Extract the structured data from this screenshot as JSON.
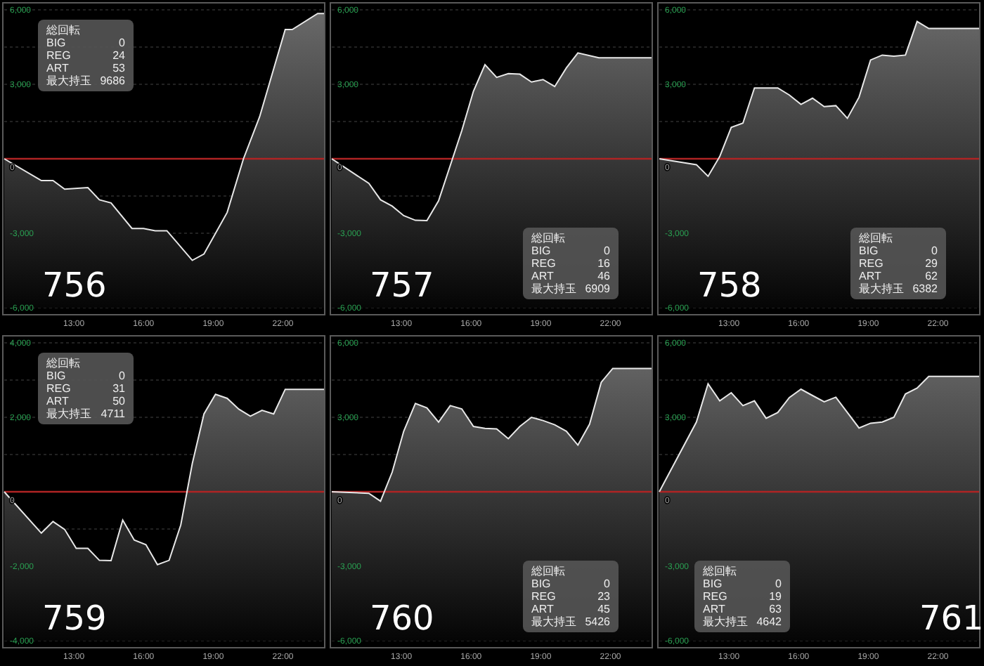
{
  "panels": [
    {
      "machine": "756",
      "stats": {
        "title": "総回転",
        "rows": [
          {
            "label": "BIG",
            "value": "0"
          },
          {
            "label": "REG",
            "value": "24"
          },
          {
            "label": "ART",
            "value": "53"
          },
          {
            "label": "最大持玉",
            "value": "9686"
          }
        ]
      },
      "chart_data": {
        "type": "line",
        "xlim": [
          10,
          23.8
        ],
        "ylim": [
          -6000,
          6000
        ],
        "xticks": [
          {
            "value": 13,
            "label": "13:00"
          },
          {
            "value": 16,
            "label": "16:00"
          },
          {
            "value": 19,
            "label": "19:00"
          },
          {
            "value": 22,
            "label": "22:00"
          }
        ],
        "yticks": [
          {
            "value": 6000,
            "label": "6,000"
          },
          {
            "value": 3000,
            "label": "3,000"
          },
          {
            "value": -3000,
            "label": "-3,000"
          },
          {
            "value": -6000,
            "label": "-6,000"
          }
        ],
        "ref_lines": [
          {
            "axis": "y",
            "value": 0,
            "label": "0",
            "color": "#b02424"
          }
        ],
        "x": [
          10,
          11.6,
          12.1,
          12.6,
          13.6,
          14.1,
          14.6,
          15.5,
          16,
          16.5,
          17,
          18.1,
          18.6,
          19.6,
          20.3,
          21,
          22.1,
          22.4,
          23.5,
          23.8
        ],
        "series": [
          {
            "color": "#e8e8e8",
            "values": [
              0,
              -880,
              -880,
              -1220,
              -1160,
              -1650,
              -1780,
              -2810,
              -2810,
              -2900,
              -2900,
              -4090,
              -3840,
              -2160,
              0,
              1690,
              5210,
              5210,
              5850,
              5850
            ]
          }
        ]
      }
    },
    {
      "machine": "757",
      "stats": {
        "title": "総回転",
        "rows": [
          {
            "label": "BIG",
            "value": "0"
          },
          {
            "label": "REG",
            "value": "16"
          },
          {
            "label": "ART",
            "value": "46"
          },
          {
            "label": "最大持玉",
            "value": "6909"
          }
        ]
      },
      "chart_data": {
        "type": "line",
        "xlim": [
          10,
          23.8
        ],
        "ylim": [
          -6000,
          6000
        ],
        "xticks": [
          {
            "value": 13,
            "label": "13:00"
          },
          {
            "value": 16,
            "label": "16:00"
          },
          {
            "value": 19,
            "label": "19:00"
          },
          {
            "value": 22,
            "label": "22:00"
          }
        ],
        "yticks": [
          {
            "value": 6000,
            "label": "6,000"
          },
          {
            "value": 3000,
            "label": "3,000"
          },
          {
            "value": -3000,
            "label": "-3,000"
          },
          {
            "value": -6000,
            "label": "-6,000"
          }
        ],
        "ref_lines": [
          {
            "axis": "y",
            "value": 0,
            "label": "0",
            "color": "#b02424"
          }
        ],
        "x": [
          10,
          11.6,
          12.1,
          12.6,
          13.1,
          13.6,
          14.1,
          14.6,
          15.6,
          16.1,
          16.6,
          17.1,
          17.6,
          18.1,
          18.6,
          19.1,
          19.6,
          20.1,
          20.6,
          21.5,
          23.8
        ],
        "series": [
          {
            "color": "#e8e8e8",
            "values": [
              0,
              -990,
              -1650,
              -1910,
              -2290,
              -2480,
              -2490,
              -1690,
              1130,
              2720,
              3790,
              3280,
              3430,
              3410,
              3090,
              3190,
              2910,
              3660,
              4260,
              4070,
              4070
            ]
          }
        ]
      }
    },
    {
      "machine": "758",
      "stats": {
        "title": "総回転",
        "rows": [
          {
            "label": "BIG",
            "value": "0"
          },
          {
            "label": "REG",
            "value": "29"
          },
          {
            "label": "ART",
            "value": "62"
          },
          {
            "label": "最大持玉",
            "value": "6382"
          }
        ]
      },
      "chart_data": {
        "type": "line",
        "xlim": [
          10,
          23.8
        ],
        "ylim": [
          -6000,
          6000
        ],
        "xticks": [
          {
            "value": 13,
            "label": "13:00"
          },
          {
            "value": 16,
            "label": "16:00"
          },
          {
            "value": 19,
            "label": "19:00"
          },
          {
            "value": 22,
            "label": "22:00"
          }
        ],
        "yticks": [
          {
            "value": 6000,
            "label": "6,000"
          },
          {
            "value": 3000,
            "label": "3,000"
          },
          {
            "value": -3000,
            "label": "-3,000"
          },
          {
            "value": -6000,
            "label": "-6,000"
          }
        ],
        "ref_lines": [
          {
            "axis": "y",
            "value": 0,
            "label": "0",
            "color": "#b02424"
          }
        ],
        "x": [
          10,
          11.6,
          12.1,
          12.6,
          13.1,
          13.6,
          14.1,
          15.1,
          15.6,
          16.1,
          16.6,
          17.1,
          17.6,
          18.1,
          18.6,
          19.1,
          19.6,
          20.1,
          20.6,
          21.1,
          21.6,
          23.8
        ],
        "series": [
          {
            "color": "#e8e8e8",
            "values": [
              0,
              -240,
              -710,
              90,
              1260,
              1440,
              2850,
              2850,
              2570,
              2190,
              2440,
              2100,
              2140,
              1630,
              2480,
              3980,
              4180,
              4130,
              4180,
              5530,
              5250,
              5250
            ]
          }
        ]
      }
    },
    {
      "machine": "759",
      "stats": {
        "title": "総回転",
        "rows": [
          {
            "label": "BIG",
            "value": "0"
          },
          {
            "label": "REG",
            "value": "31"
          },
          {
            "label": "ART",
            "value": "50"
          },
          {
            "label": "最大持玉",
            "value": "4711"
          }
        ]
      },
      "chart_data": {
        "type": "line",
        "xlim": [
          10,
          23.8
        ],
        "ylim": [
          -4000,
          4000
        ],
        "xticks": [
          {
            "value": 13,
            "label": "13:00"
          },
          {
            "value": 16,
            "label": "16:00"
          },
          {
            "value": 19,
            "label": "19:00"
          },
          {
            "value": 22,
            "label": "22:00"
          }
        ],
        "yticks": [
          {
            "value": 4000,
            "label": "4,000"
          },
          {
            "value": 2000,
            "label": "2,000"
          },
          {
            "value": -2000,
            "label": "-2,000"
          },
          {
            "value": -4000,
            "label": "-4,000"
          }
        ],
        "ref_lines": [
          {
            "axis": "y",
            "value": 0,
            "label": "0",
            "color": "#b02424"
          }
        ],
        "x": [
          10,
          11.6,
          12.1,
          12.6,
          13.1,
          13.6,
          14.1,
          14.6,
          15.1,
          15.6,
          16.1,
          16.6,
          17.1,
          17.6,
          18.1,
          18.6,
          19.1,
          19.6,
          20.1,
          20.6,
          21.1,
          21.6,
          22.1,
          23.8
        ],
        "series": [
          {
            "color": "#e8e8e8",
            "values": [
              0,
              -1110,
              -800,
              -1010,
              -1520,
              -1520,
              -1840,
              -1850,
              -760,
              -1300,
              -1420,
              -1960,
              -1840,
              -890,
              760,
              2090,
              2620,
              2510,
              2220,
              2030,
              2190,
              2090,
              2750,
              2750
            ]
          }
        ]
      }
    },
    {
      "machine": "760",
      "stats": {
        "title": "総回転",
        "rows": [
          {
            "label": "BIG",
            "value": "0"
          },
          {
            "label": "REG",
            "value": "23"
          },
          {
            "label": "ART",
            "value": "45"
          },
          {
            "label": "最大持玉",
            "value": "5426"
          }
        ]
      },
      "chart_data": {
        "type": "line",
        "xlim": [
          10,
          23.8
        ],
        "ylim": [
          -6000,
          6000
        ],
        "xticks": [
          {
            "value": 13,
            "label": "13:00"
          },
          {
            "value": 16,
            "label": "16:00"
          },
          {
            "value": 19,
            "label": "19:00"
          },
          {
            "value": 22,
            "label": "22:00"
          }
        ],
        "yticks": [
          {
            "value": 6000,
            "label": "6,000"
          },
          {
            "value": 3000,
            "label": "3,000"
          },
          {
            "value": -3000,
            "label": "-3,000"
          },
          {
            "value": -6000,
            "label": "-6,000"
          }
        ],
        "ref_lines": [
          {
            "axis": "y",
            "value": 0,
            "label": "0",
            "color": "#b02424"
          }
        ],
        "x": [
          10,
          11.6,
          12.1,
          12.6,
          13.1,
          13.6,
          14.1,
          14.6,
          15.1,
          15.6,
          16.1,
          16.6,
          17.1,
          17.6,
          18.1,
          18.6,
          19.1,
          19.6,
          20.1,
          20.6,
          21.1,
          21.6,
          22.1,
          23.8
        ],
        "series": [
          {
            "color": "#e8e8e8",
            "values": [
              0,
              -60,
              -380,
              790,
              2440,
              3560,
              3380,
              2810,
              3470,
              3340,
              2630,
              2550,
              2530,
              2140,
              2630,
              3000,
              2870,
              2700,
              2440,
              1880,
              2720,
              4410,
              4970,
              4970
            ]
          }
        ]
      }
    },
    {
      "machine": "761",
      "stats": {
        "title": "総回転",
        "rows": [
          {
            "label": "BIG",
            "value": "0"
          },
          {
            "label": "REG",
            "value": "19"
          },
          {
            "label": "ART",
            "value": "63"
          },
          {
            "label": "最大持玉",
            "value": "4642"
          }
        ]
      },
      "chart_data": {
        "type": "line",
        "xlim": [
          10,
          23.8
        ],
        "ylim": [
          -6000,
          6000
        ],
        "xticks": [
          {
            "value": 13,
            "label": "13:00"
          },
          {
            "value": 16,
            "label": "16:00"
          },
          {
            "value": 19,
            "label": "19:00"
          },
          {
            "value": 22,
            "label": "22:00"
          }
        ],
        "yticks": [
          {
            "value": 6000,
            "label": "6,000"
          },
          {
            "value": 3000,
            "label": "3,000"
          },
          {
            "value": -3000,
            "label": "-3,000"
          },
          {
            "value": -6000,
            "label": "-6,000"
          }
        ],
        "ref_lines": [
          {
            "axis": "y",
            "value": 0,
            "label": "0",
            "color": "#b02424"
          }
        ],
        "x": [
          10,
          11.6,
          12.1,
          12.6,
          13.1,
          13.6,
          14.1,
          14.6,
          15.1,
          15.6,
          16.1,
          16.6,
          17.1,
          17.6,
          18.1,
          18.6,
          19.1,
          19.6,
          20.1,
          20.6,
          21.1,
          21.6,
          23.8
        ],
        "series": [
          {
            "color": "#e8e8e8",
            "values": [
              0,
              2810,
              4350,
              3660,
              3990,
              3470,
              3660,
              2960,
              3190,
              3790,
              4130,
              3880,
              3620,
              3810,
              3190,
              2570,
              2760,
              2810,
              3000,
              3940,
              4180,
              4650,
              4650
            ]
          }
        ]
      }
    }
  ]
}
